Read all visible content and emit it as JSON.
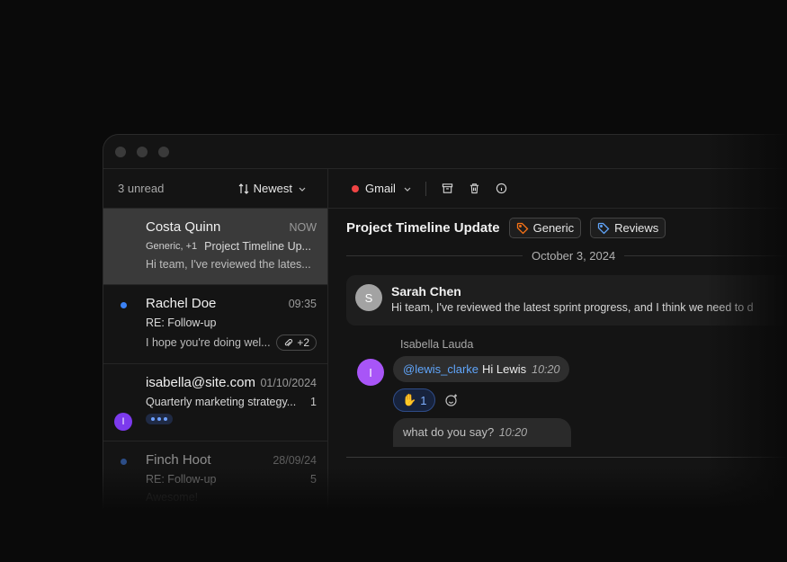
{
  "sidebar": {
    "unread_label": "3 unread",
    "sort_label": "Newest",
    "items": [
      {
        "name": "Costa Quinn",
        "time": "NOW",
        "tags": "Generic, +1",
        "subject": "Project Timeline Up...",
        "preview": "Hi team, I've reviewed the lates..."
      },
      {
        "name": "Rachel Doe",
        "time": "09:35",
        "subject": "RE: Follow-up",
        "preview": "I hope you're doing wel...",
        "attachments": "+2"
      },
      {
        "name": "isabella@site.com",
        "time": "01/10/2024",
        "subject": "Quarterly marketing strategy...",
        "count": "1",
        "avatar_initial": "I"
      },
      {
        "name": "Finch Hoot",
        "time": "28/09/24",
        "subject": "RE: Follow-up",
        "count": "5",
        "preview": "Awesome!"
      }
    ]
  },
  "toolbar": {
    "account": "Gmail"
  },
  "thread": {
    "title": "Project Timeline Update",
    "tags": [
      {
        "label": "Generic",
        "color": "#f97316"
      },
      {
        "label": "Reviews",
        "color": "#60a5fa"
      }
    ],
    "date": "October 3, 2024",
    "message": {
      "initial": "S",
      "sender": "Sarah Chen",
      "preview": "Hi team, I've reviewed the latest sprint progress, and I think we need to d"
    },
    "chat": {
      "initial": "I",
      "name": "Isabella Lauda",
      "mention": "@lewis_clarke",
      "text": "Hi Lewis",
      "time": "10:20",
      "reaction_emoji": "✋",
      "reaction_count": "1",
      "reply_text": "what do you say?",
      "reply_time": "10:20"
    }
  }
}
